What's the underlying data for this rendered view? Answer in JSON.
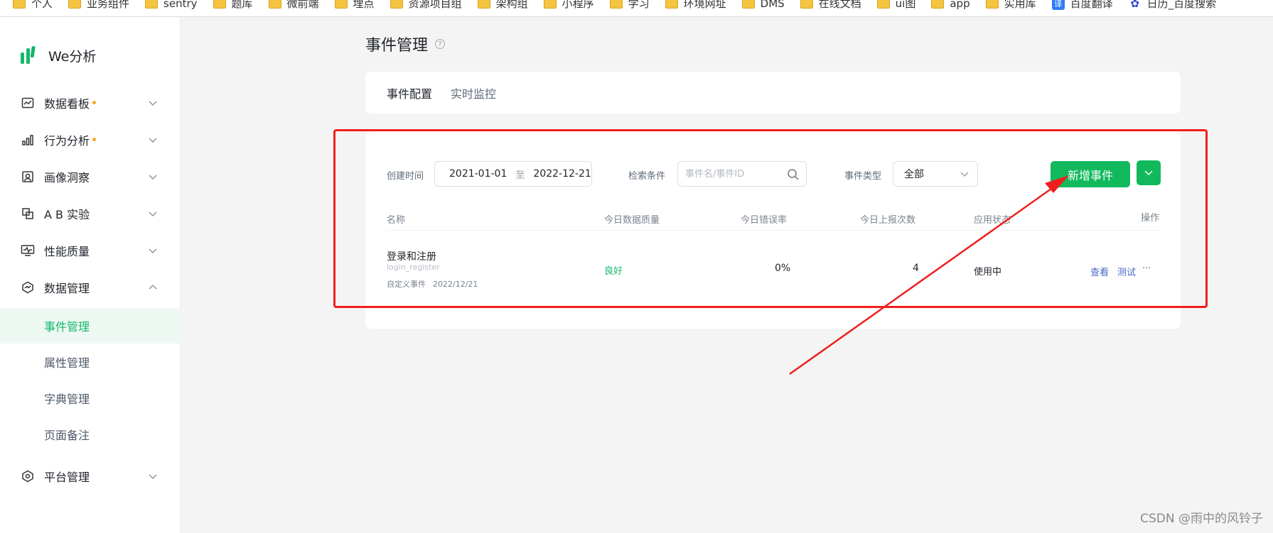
{
  "bookmarks": [
    {
      "label": "个人",
      "icon": "folder-icon"
    },
    {
      "label": "业务组件",
      "icon": "folder-icon"
    },
    {
      "label": "sentry",
      "icon": "folder-icon"
    },
    {
      "label": "题库",
      "icon": "folder-icon"
    },
    {
      "label": "微前端",
      "icon": "folder-icon"
    },
    {
      "label": "埋点",
      "icon": "folder-icon"
    },
    {
      "label": "资源项目组",
      "icon": "folder-icon"
    },
    {
      "label": "架构组",
      "icon": "folder-icon"
    },
    {
      "label": "小程序",
      "icon": "folder-icon"
    },
    {
      "label": "学习",
      "icon": "folder-icon"
    },
    {
      "label": "环境网址",
      "icon": "folder-icon"
    },
    {
      "label": "DMS",
      "icon": "folder-icon"
    },
    {
      "label": "在线文档",
      "icon": "folder-icon"
    },
    {
      "label": "ui图",
      "icon": "folder-icon"
    },
    {
      "label": "app",
      "icon": "folder-icon"
    },
    {
      "label": "实用库",
      "icon": "folder-icon"
    },
    {
      "label": "百度翻译",
      "icon": "translate-icon"
    },
    {
      "label": "日历_百度搜索",
      "icon": "baidu-paw-icon"
    }
  ],
  "logo": {
    "text": "We分析"
  },
  "sidebar": {
    "items": [
      {
        "label": "数据看板",
        "icon": "dashboard-icon",
        "dot": true
      },
      {
        "label": "行为分析",
        "icon": "bar-chart-icon",
        "dot": true
      },
      {
        "label": "画像洞察",
        "icon": "portrait-icon",
        "dot": false
      },
      {
        "label": "A B 实验",
        "icon": "ab-test-icon",
        "dot": false
      },
      {
        "label": "性能质量",
        "icon": "monitor-icon",
        "dot": false
      },
      {
        "label": "数据管理",
        "icon": "data-manage-icon",
        "dot": false,
        "expanded": true
      },
      {
        "label": "平台管理",
        "icon": "platform-icon",
        "dot": false
      }
    ],
    "sub_items": [
      "事件管理",
      "属性管理",
      "字典管理",
      "页面备注"
    ],
    "active_sub": "事件管理"
  },
  "page": {
    "title": "事件管理",
    "help_icon": "?"
  },
  "tabs": [
    "事件配置",
    "实时监控"
  ],
  "filters": {
    "created_label": "创建时间",
    "date_start": "2021-01-01",
    "date_sep": "至",
    "date_end": "2022-12-21",
    "search_label": "检索条件",
    "search_placeholder": "事件名/事件ID",
    "type_label": "事件类型",
    "type_value": "全部",
    "add_button": "新增事件"
  },
  "table": {
    "columns": [
      "名称",
      "今日数据质量",
      "今日错误率",
      "今日上报次数",
      "应用状态",
      "操作"
    ],
    "rows": [
      {
        "name": "登录和注册",
        "code": "login_register",
        "type": "自定义事件",
        "date": "2022/12/21",
        "quality": "良好",
        "error_rate": "0%",
        "report_count": "4",
        "status": "使用中",
        "actions": [
          "查看",
          "测试",
          "···"
        ]
      }
    ]
  },
  "colors": {
    "primary": "#12b95c",
    "annotation": "#f01e1e",
    "link": "#4a68c7",
    "dot": "#f5a623"
  },
  "watermark": "CSDN @雨中的风铃子"
}
